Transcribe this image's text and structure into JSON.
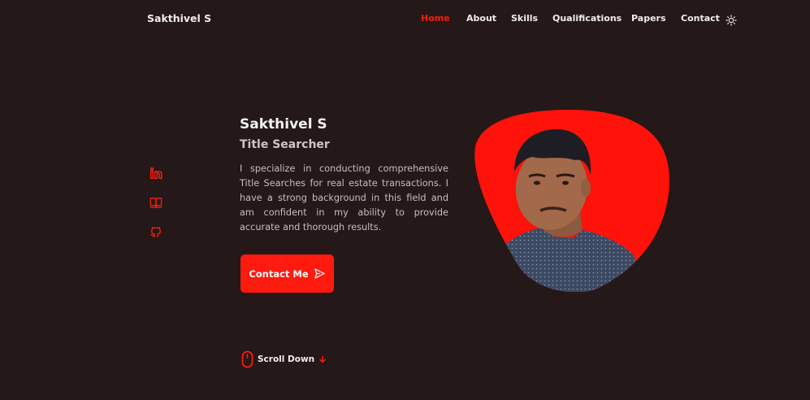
{
  "brand": {
    "name": "Sakthivel S"
  },
  "nav": {
    "items": [
      {
        "label": "Home",
        "active": true
      },
      {
        "label": "About",
        "active": false
      },
      {
        "label": "Skills",
        "active": false
      },
      {
        "label": "Qualifications",
        "active": false
      },
      {
        "label": "Papers",
        "active": false
      },
      {
        "label": "Contact",
        "active": false
      }
    ],
    "theme_toggle_icon": "sun-icon"
  },
  "socials": [
    {
      "icon": "linkedin-icon"
    },
    {
      "icon": "book-icon"
    },
    {
      "icon": "github-icon"
    }
  ],
  "intro": {
    "name": "Sakthivel S",
    "role": "Title Searcher",
    "description": "I specialize in conducting comprehensive Title Searches for real estate transactions. I have a strong background in this field and am confident in my ability to provide accurate and thorough results.",
    "contact_label": "Contact Me",
    "contact_icon": "send-icon"
  },
  "scroll": {
    "label": "Scroll Down",
    "icon": "mouse-icon",
    "arrow_icon": "arrow-down-icon"
  },
  "colors": {
    "accent": "#ff1a0f",
    "background": "#241818",
    "text": "#f2eded"
  }
}
